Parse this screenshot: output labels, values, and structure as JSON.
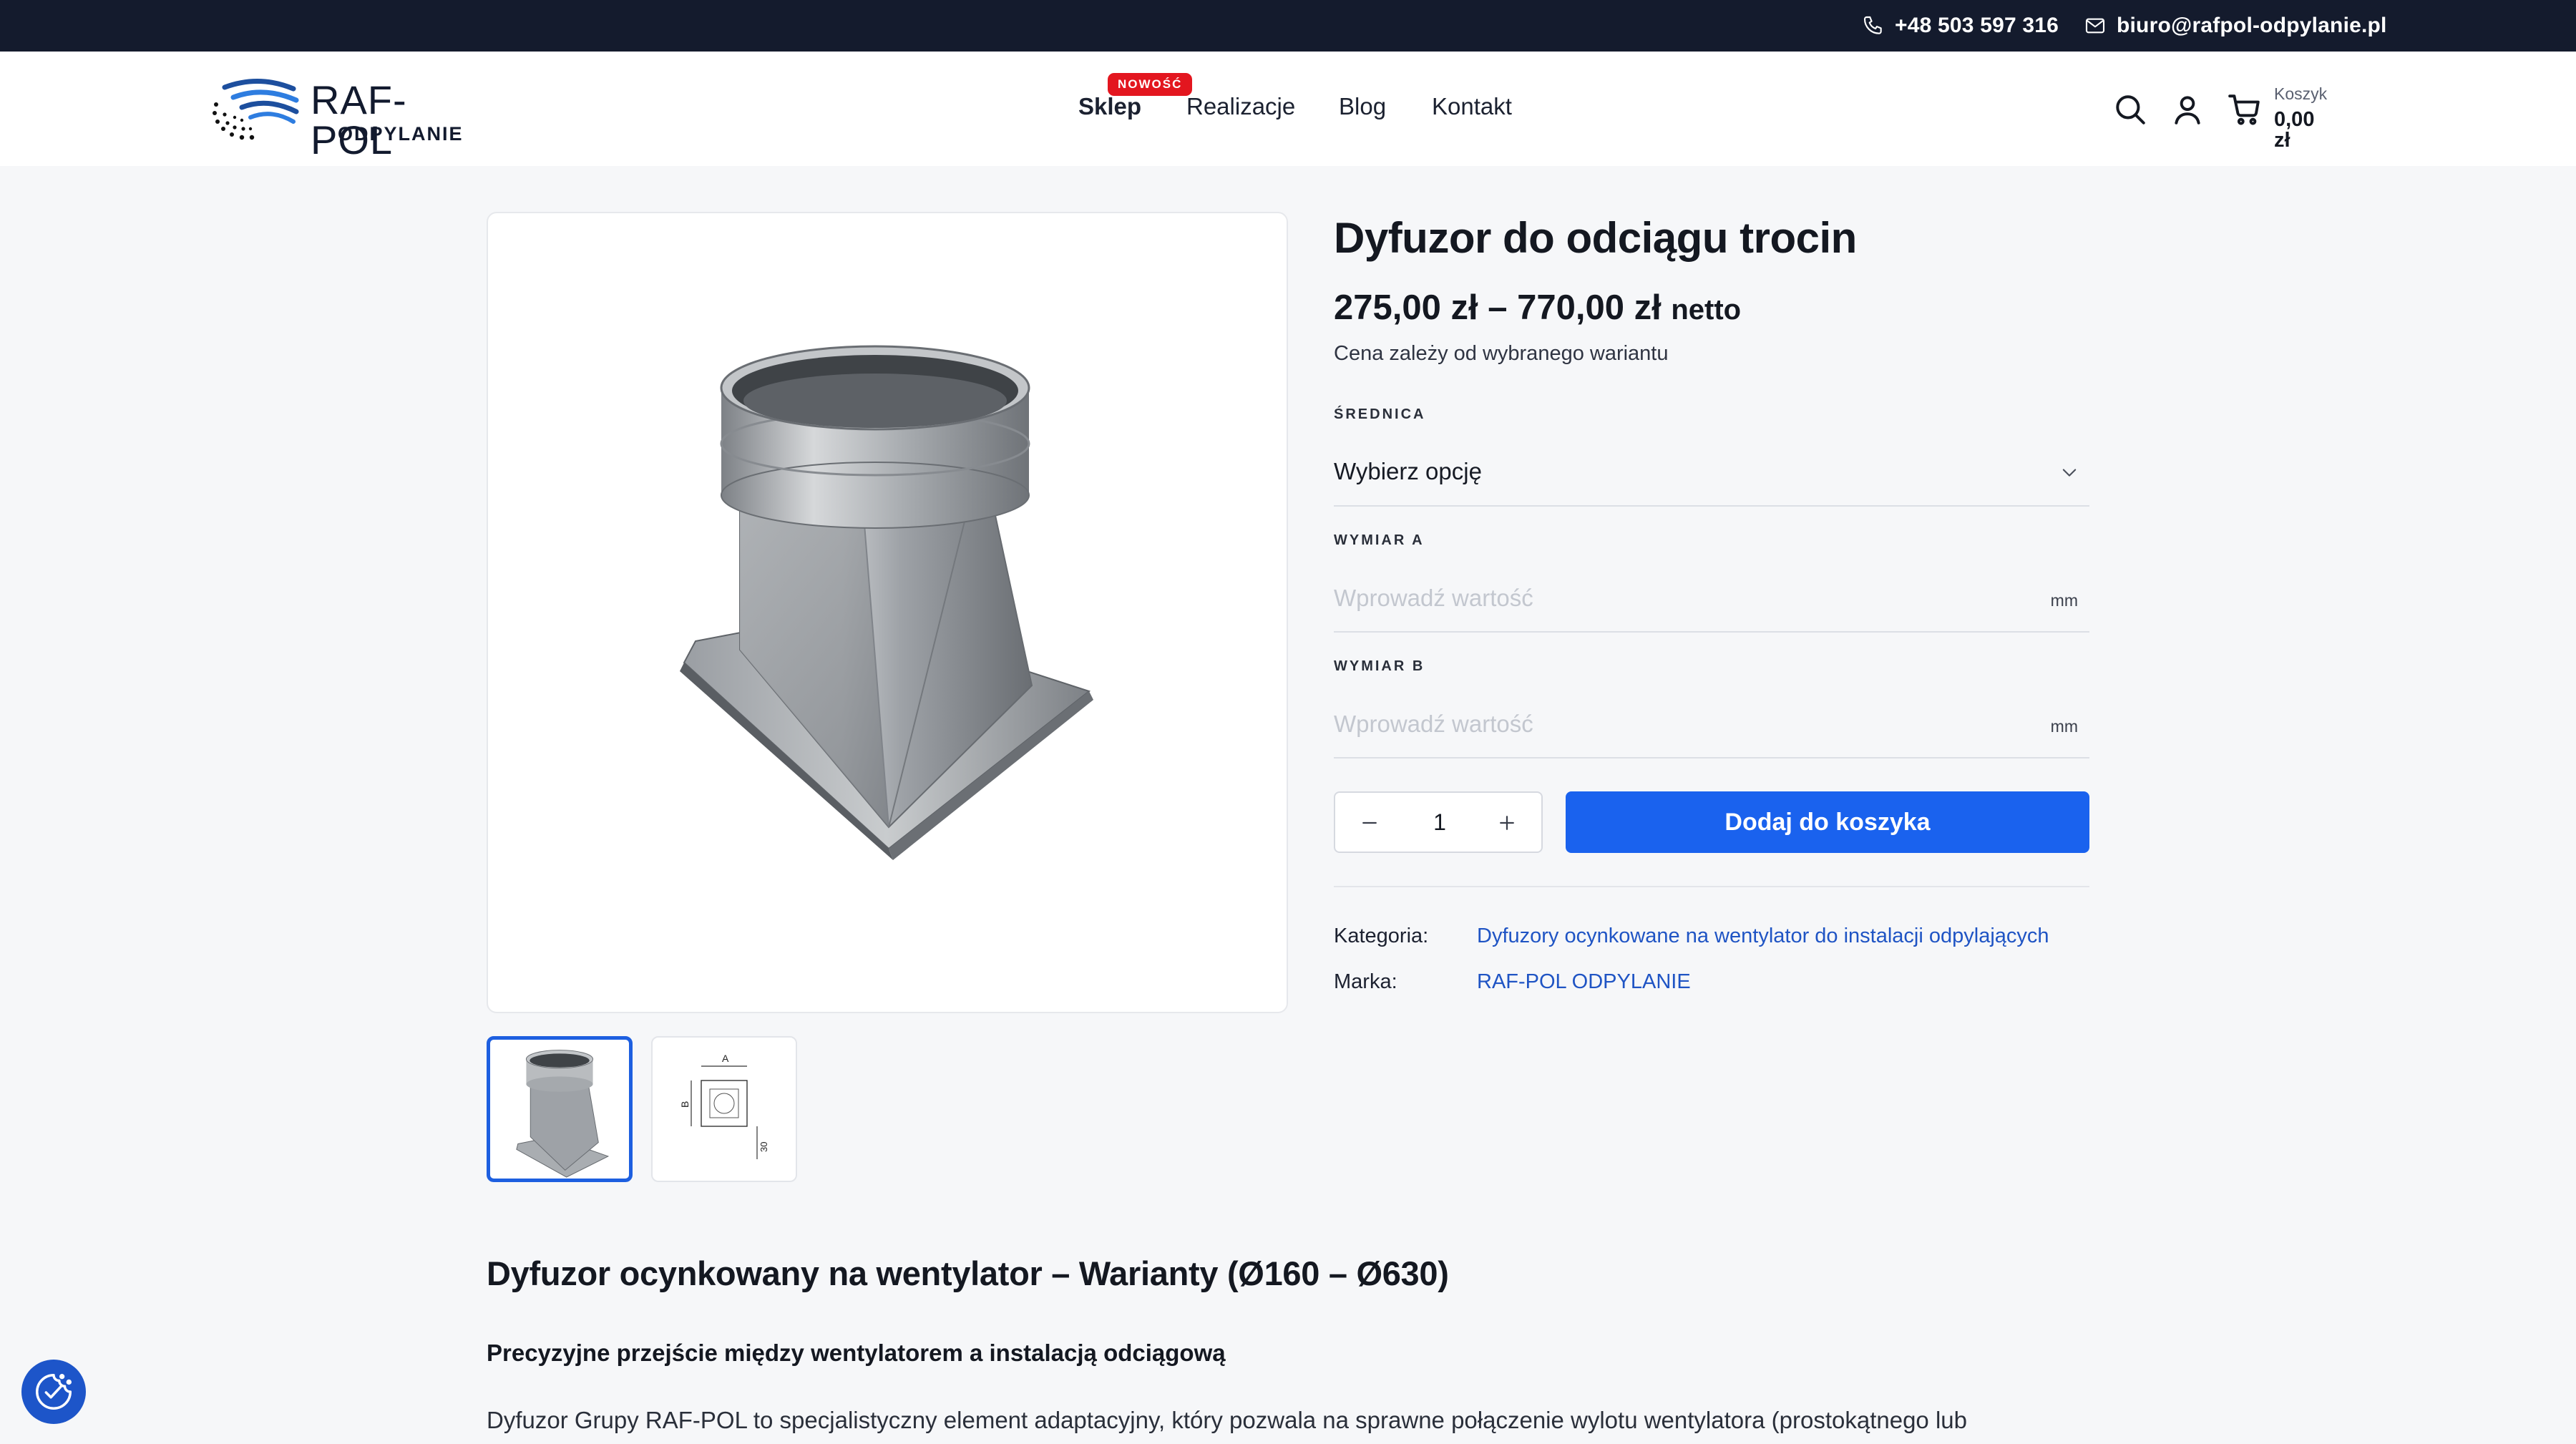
{
  "topbar": {
    "phone": "+48 503 597 316",
    "email": "biuro@rafpol-odpylanie.pl"
  },
  "header": {
    "logo": {
      "brand": "RAF-POL",
      "sub": "ODPYLANIE"
    },
    "nav": {
      "shop": "Sklep",
      "shop_badge": "NOWOŚĆ",
      "realizations": "Realizacje",
      "blog": "Blog",
      "contact": "Kontakt"
    },
    "cart": {
      "label": "Koszyk",
      "value": "0,00 zł"
    }
  },
  "product": {
    "title": "Dyfuzor do odciągu trocin",
    "price": "275,00 zł – 770,00 zł",
    "price_suffix": "netto",
    "price_note": "Cena zależy od wybranego wariantu",
    "fields": {
      "diameter_label": "ŚREDNICA",
      "diameter_value": "Wybierz opcję",
      "dim_a_label": "WYMIAR A",
      "dim_a_placeholder": "Wprowadź wartość",
      "dim_a_unit": "mm",
      "dim_b_label": "WYMIAR B",
      "dim_b_placeholder": "Wprowadź wartość",
      "dim_b_unit": "mm"
    },
    "quantity": "1",
    "add_to_cart": "Dodaj do koszyka",
    "meta": {
      "category_label": "Kategoria:",
      "category_value": "Dyfuzory ocynkowane na wentylator do instalacji odpylających",
      "brand_label": "Marka:",
      "brand_value": "RAF-POL ODPYLANIE"
    },
    "thumb_drawing": {
      "a": "A",
      "b": "B",
      "c": "30"
    }
  },
  "description": {
    "heading": "Dyfuzor ocynkowany na wentylator – Warianty (Ø160 – Ø630)",
    "subheading": "Precyzyjne przejście między wentylatorem a instalacją odciągową",
    "paragraph": "Dyfuzor Grupy RAF-POL to specjalistyczny element adaptacyjny, który pozwala na sprawne połączenie wylotu wentylatora (prostokątnego lub"
  },
  "colors": {
    "topbar": "#141b2d",
    "accent": "#1a62ee",
    "badge": "#e3161f",
    "link": "#1f54c4"
  },
  "icons": {
    "phone": "phone-icon",
    "mail": "mail-icon",
    "search": "search-icon",
    "user": "user-icon",
    "cart": "cart-icon",
    "chevron": "chevron-down-icon",
    "minus": "minus-icon",
    "plus": "plus-icon",
    "cookie": "cookie-settings-icon"
  }
}
